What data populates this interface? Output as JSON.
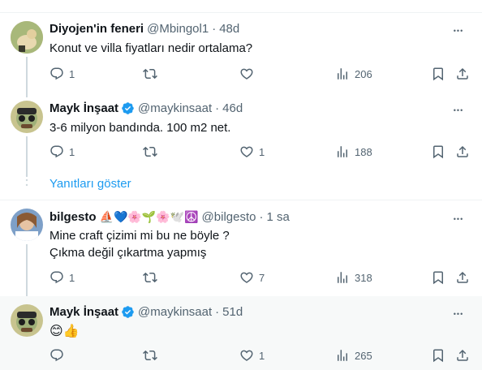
{
  "tweets": [
    {
      "name": "Diyojen'in feneri",
      "handle": "@Mbingol1",
      "time": "48d",
      "verified": false,
      "lines": [
        "Konut ve villa fiyatları nedir ortalama?"
      ],
      "reply_count": "1",
      "retweet_count": "",
      "like_count": "",
      "view_count": "206",
      "avatar_color": "#c6b18a"
    },
    {
      "name": "Mayk İnşaat",
      "handle": "@maykinsaat",
      "time": "46d",
      "verified": true,
      "lines": [
        "3-6 milyon bandında. 100 m2 net."
      ],
      "reply_count": "1",
      "retweet_count": "",
      "like_count": "1",
      "view_count": "188",
      "avatar_color": "#8b9d6b"
    },
    {
      "name": "bilgesto",
      "name_emojis": "⛵💙🌸🌱🌸🕊️☮️",
      "handle": "@bilgesto",
      "time": "1 sa",
      "verified": false,
      "lines": [
        "Mine craft çizimi mi bu ne böyle ?",
        "Çıkma değil çıkartma yapmış"
      ],
      "reply_count": "1",
      "retweet_count": "",
      "like_count": "7",
      "view_count": "318",
      "avatar_color": "#b89b7a"
    },
    {
      "name": "Mayk İnşaat",
      "handle": "@maykinsaat",
      "time": "51d",
      "verified": true,
      "lines": [
        "😊👍"
      ],
      "reply_count": "",
      "retweet_count": "",
      "like_count": "1",
      "view_count": "265",
      "avatar_color": "#8b9d6b"
    }
  ],
  "show_replies_label": "Yanıtları göster",
  "dot": "·",
  "more_glyph": "•••",
  "colors": {
    "link": "#1d9bf0",
    "muted": "#536471",
    "hover_bg": "#f7f9f9"
  }
}
